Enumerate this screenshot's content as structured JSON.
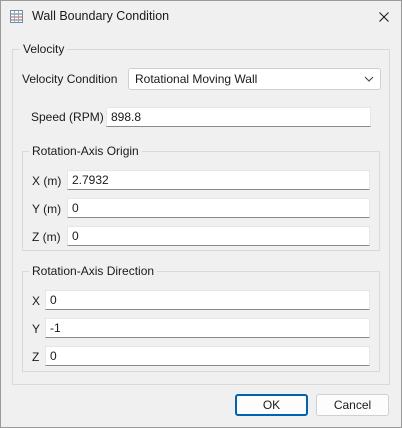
{
  "window": {
    "title": "Wall Boundary Condition"
  },
  "velocity_group": {
    "label": "Velocity",
    "condition_label": "Velocity Condition",
    "condition_value": "Rotational Moving Wall",
    "speed_label": "Speed (RPM)",
    "speed_value": "898.8"
  },
  "origin_group": {
    "label": "Rotation-Axis Origin",
    "x_label": "X (m)",
    "x_value": "2.7932",
    "y_label": "Y (m)",
    "y_value": "0",
    "z_label": "Z (m)",
    "z_value": "0"
  },
  "direction_group": {
    "label": "Rotation-Axis Direction",
    "x_label": "X",
    "x_value": "0",
    "y_label": "Y",
    "y_value": "-1",
    "z_label": "Z",
    "z_value": "0"
  },
  "buttons": {
    "ok": "OK",
    "cancel": "Cancel"
  },
  "icons": {
    "app": "grid-app-icon",
    "close": "close-icon",
    "dropdown": "chevron-down-icon"
  },
  "colors": {
    "default_button_border": "#0063b1",
    "window_bg": "#f0f0f0"
  }
}
